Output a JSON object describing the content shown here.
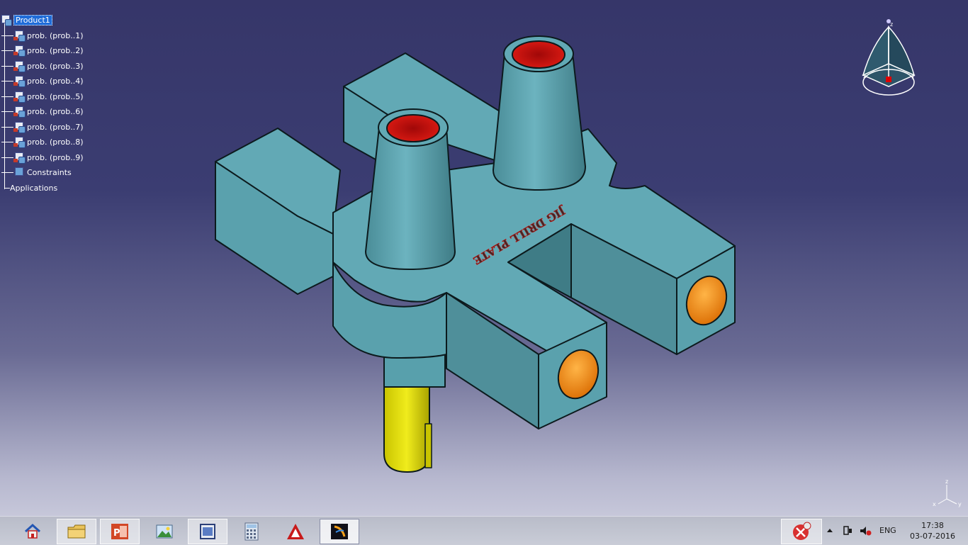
{
  "tree": {
    "root": "Product1",
    "items": [
      {
        "label": "prob. (prob..1)"
      },
      {
        "label": "prob. (prob..2)"
      },
      {
        "label": "prob. (prob..3)"
      },
      {
        "label": "prob. (prob..4)"
      },
      {
        "label": "prob. (prob..5)"
      },
      {
        "label": "prob. (prob..6)"
      },
      {
        "label": "prob. (prob..7)"
      },
      {
        "label": "prob. (prob..8)"
      },
      {
        "label": "prob. (prob..9)"
      }
    ],
    "constraints": "Constraints",
    "applications": "Applications"
  },
  "model": {
    "engraving": "JIG DRILL PLATE",
    "colors": {
      "body": "#62a9b5",
      "body_dark": "#4f8f9a",
      "bushing_hole": "#c4120e",
      "side_hole": "#f08a0a",
      "pin": "#d7d20a"
    }
  },
  "compass": {
    "z": "z",
    "x": "x",
    "y": "y"
  },
  "axis": {
    "z": "z",
    "x": "x",
    "y": "y"
  },
  "taskbar": {
    "apps": [
      {
        "name": "home",
        "icon": "home-icon"
      },
      {
        "name": "explorer",
        "icon": "folder-icon"
      },
      {
        "name": "powerpoint",
        "icon": "powerpoint-icon"
      },
      {
        "name": "photos",
        "icon": "photo-viewer-icon"
      },
      {
        "name": "paint",
        "icon": "window-icon"
      },
      {
        "name": "calculator",
        "icon": "calculator-icon"
      },
      {
        "name": "autocad",
        "icon": "autocad-icon"
      },
      {
        "name": "catia",
        "icon": "catia-icon"
      }
    ],
    "lang": "ENG",
    "time": "17:38",
    "date": "03-07-2016"
  }
}
